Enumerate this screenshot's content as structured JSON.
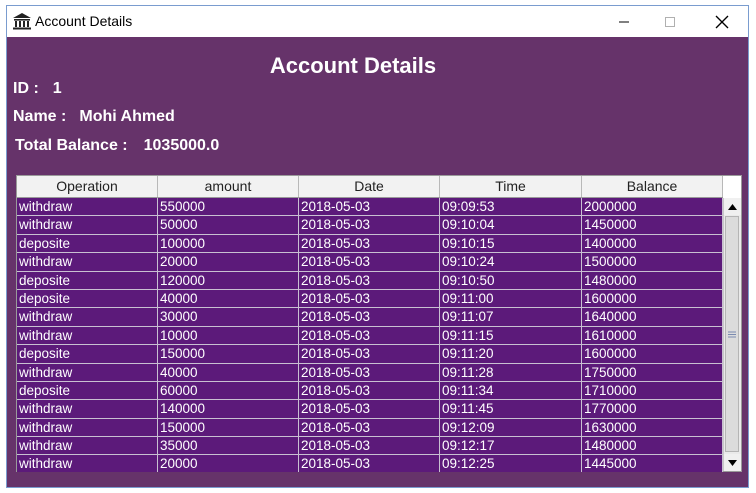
{
  "window": {
    "title": "Account Details",
    "icon": "bank-icon"
  },
  "header": {
    "title": "Account Details"
  },
  "account": {
    "id_label": "ID :",
    "id_value": "1",
    "name_label": "Name :",
    "name_value": "Mohi Ahmed",
    "balance_label": "Total Balance :",
    "balance_value": "1035000.0"
  },
  "table": {
    "columns": [
      "Operation",
      "amount",
      "Date",
      "Time",
      "Balance"
    ],
    "rows": [
      [
        "withdraw",
        "550000",
        "2018-05-03",
        "09:09:53",
        "2000000"
      ],
      [
        "withdraw",
        "50000",
        "2018-05-03",
        "09:10:04",
        "1450000"
      ],
      [
        "deposite",
        "100000",
        "2018-05-03",
        "09:10:15",
        "1400000"
      ],
      [
        "withdraw",
        "20000",
        "2018-05-03",
        "09:10:24",
        "1500000"
      ],
      [
        "deposite",
        "120000",
        "2018-05-03",
        "09:10:50",
        "1480000"
      ],
      [
        "deposite",
        "40000",
        "2018-05-03",
        "09:11:00",
        "1600000"
      ],
      [
        "withdraw",
        "30000",
        "2018-05-03",
        "09:11:07",
        "1640000"
      ],
      [
        "withdraw",
        "10000",
        "2018-05-03",
        "09:11:15",
        "1610000"
      ],
      [
        "deposite",
        "150000",
        "2018-05-03",
        "09:11:20",
        "1600000"
      ],
      [
        "withdraw",
        "40000",
        "2018-05-03",
        "09:11:28",
        "1750000"
      ],
      [
        "deposite",
        "60000",
        "2018-05-03",
        "09:11:34",
        "1710000"
      ],
      [
        "withdraw",
        "140000",
        "2018-05-03",
        "09:11:45",
        "1770000"
      ],
      [
        "withdraw",
        "150000",
        "2018-05-03",
        "09:12:09",
        "1630000"
      ],
      [
        "withdraw",
        "35000",
        "2018-05-03",
        "09:12:17",
        "1480000"
      ],
      [
        "withdraw",
        "20000",
        "2018-05-03",
        "09:12:25",
        "1445000"
      ]
    ]
  },
  "colors": {
    "window_background": "#66336a",
    "table_background": "#5c1a7a",
    "header_background": "#f2f2f2"
  }
}
